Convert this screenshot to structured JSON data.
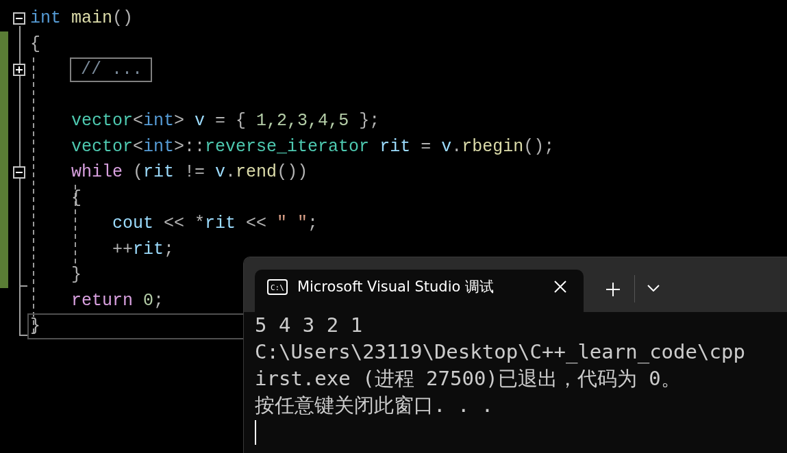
{
  "editor": {
    "lines": [
      {
        "folded": false,
        "changed": false,
        "current": false,
        "tokens": [
          {
            "t": "int",
            "kind": "type"
          },
          {
            "t": " main",
            "kind": "func"
          },
          {
            "t": "()",
            "kind": "punct"
          }
        ]
      },
      {
        "changed": true,
        "current": false,
        "tokens": [
          {
            "t": "{",
            "kind": "punct"
          }
        ]
      },
      {
        "folded": true,
        "changed": true,
        "current": false,
        "collapsed": "// ..."
      },
      {
        "changed": true,
        "current": false
      },
      {
        "changed": true,
        "current": false,
        "tokens": [
          {
            "t": "    vector",
            "kind": "class"
          },
          {
            "t": "<",
            "kind": "punct"
          },
          {
            "t": "int",
            "kind": "type"
          },
          {
            "t": ">",
            "kind": "punct"
          },
          {
            "t": " v",
            "kind": "var"
          },
          {
            "t": " = { ",
            "kind": "punct"
          },
          {
            "t": "1,2,3,4,5",
            "kind": "number"
          },
          {
            "t": " };",
            "kind": "punct"
          }
        ]
      },
      {
        "changed": true,
        "current": false,
        "tokens": [
          {
            "t": "    vector",
            "kind": "class"
          },
          {
            "t": "<",
            "kind": "punct"
          },
          {
            "t": "int",
            "kind": "type"
          },
          {
            "t": ">::",
            "kind": "punct"
          },
          {
            "t": "reverse_iterator",
            "kind": "class"
          },
          {
            "t": " rit",
            "kind": "var"
          },
          {
            "t": " = ",
            "kind": "punct"
          },
          {
            "t": "v",
            "kind": "var"
          },
          {
            "t": ".",
            "kind": "punct"
          },
          {
            "t": "rbegin",
            "kind": "func"
          },
          {
            "t": "();",
            "kind": "punct"
          }
        ]
      },
      {
        "folded": false,
        "changed": true,
        "current": false,
        "tokens": [
          {
            "t": "    while",
            "kind": "control"
          },
          {
            "t": " (",
            "kind": "punct"
          },
          {
            "t": "rit",
            "kind": "var"
          },
          {
            "t": " != ",
            "kind": "punct"
          },
          {
            "t": "v",
            "kind": "var"
          },
          {
            "t": ".",
            "kind": "punct"
          },
          {
            "t": "rend",
            "kind": "func"
          },
          {
            "t": "())",
            "kind": "punct"
          }
        ]
      },
      {
        "changed": true,
        "current": false,
        "tokens": [
          {
            "t": "    {",
            "kind": "punct"
          }
        ]
      },
      {
        "changed": true,
        "current": false,
        "tokens": [
          {
            "t": "        cout",
            "kind": "var"
          },
          {
            "t": " << *",
            "kind": "punct"
          },
          {
            "t": "rit",
            "kind": "var"
          },
          {
            "t": " << ",
            "kind": "punct"
          },
          {
            "t": "\" \"",
            "kind": "string"
          },
          {
            "t": ";",
            "kind": "punct"
          }
        ]
      },
      {
        "changed": true,
        "current": false,
        "tokens": [
          {
            "t": "        ++",
            "kind": "punct"
          },
          {
            "t": "rit",
            "kind": "var"
          },
          {
            "t": ";",
            "kind": "punct"
          }
        ]
      },
      {
        "changed": true,
        "current": false,
        "tokens": [
          {
            "t": "    }",
            "kind": "punct"
          }
        ]
      },
      {
        "changed": false,
        "current": false,
        "tokens": [
          {
            "t": "    return",
            "kind": "control"
          },
          {
            "t": " 0",
            "kind": "number"
          },
          {
            "t": ";",
            "kind": "punct"
          }
        ]
      },
      {
        "changed": false,
        "current": true,
        "tokens": [
          {
            "t": "}",
            "kind": "punct"
          }
        ]
      }
    ]
  },
  "console": {
    "tab": {
      "icon_label": "C:\\",
      "title": "Microsoft Visual Studio 调试",
      "selected": true
    },
    "output": [
      "5 4 3 2 1",
      "C:\\Users\\23119\\Desktop\\C++_learn_code\\cpp",
      "irst.exe (进程 27500)已退出，代码为 0。",
      "按任意键关闭此窗口. . ."
    ]
  }
}
